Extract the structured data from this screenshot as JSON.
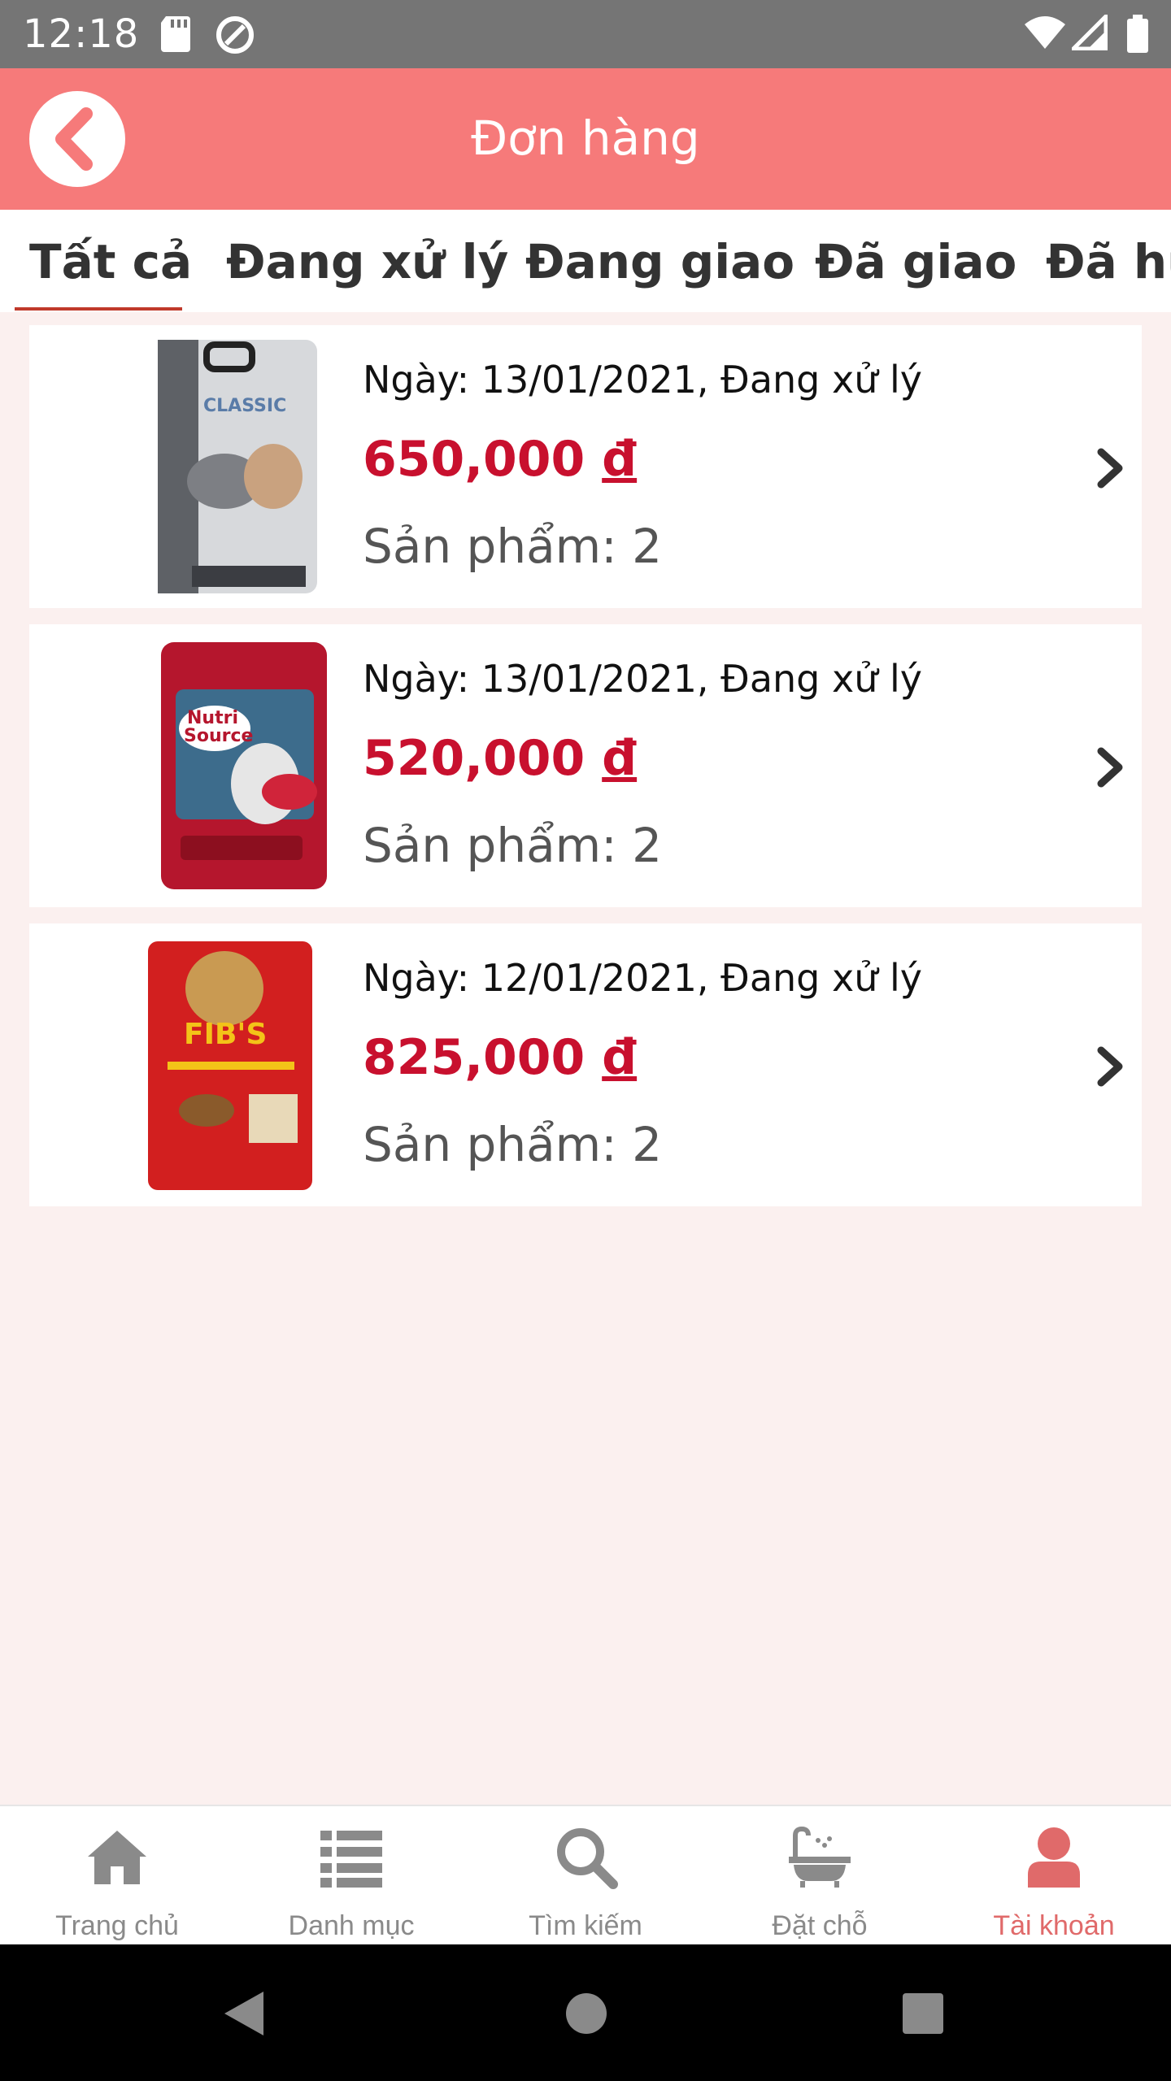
{
  "status_bar": {
    "time": "12:18"
  },
  "header": {
    "title": "Đơn hàng"
  },
  "tabs": [
    {
      "label": "Tất cả"
    },
    {
      "label": "Đang xử lý"
    },
    {
      "label": "Đang giao"
    },
    {
      "label": "Đã giao"
    },
    {
      "label": "Đã hủ"
    }
  ],
  "orders": [
    {
      "date_text": "Ngày: 13/01/2021, Đang xử lý",
      "price": "650,000",
      "currency": "đ",
      "count_text": "Sản phẩm: 2",
      "image": "classic-dog-food-bag"
    },
    {
      "date_text": "Ngày: 13/01/2021, Đang xử lý",
      "price": "520,000",
      "currency": "đ",
      "count_text": "Sản phẩm: 2",
      "image": "nutri-source-dog-food-bag"
    },
    {
      "date_text": "Ngày: 12/01/2021, Đang xử lý",
      "price": "825,000",
      "currency": "đ",
      "count_text": "Sản phẩm: 2",
      "image": "fibs-dog-food-bag"
    }
  ],
  "bottom_nav": [
    {
      "label": "Trang chủ",
      "icon": "home-icon"
    },
    {
      "label": "Danh mục",
      "icon": "list-icon"
    },
    {
      "label": "Tìm kiếm",
      "icon": "search-icon"
    },
    {
      "label": "Đặt chỗ",
      "icon": "bathtub-icon"
    },
    {
      "label": "Tài khoản",
      "icon": "user-icon",
      "active": true
    }
  ],
  "colors": {
    "header": "#f67a7a",
    "price": "#c8102e",
    "active_nav": "#e06a6a",
    "background": "#fbf0ef"
  }
}
